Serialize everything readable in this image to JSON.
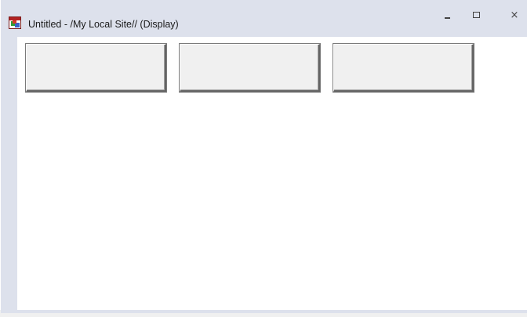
{
  "window": {
    "title": "Untitled - /My Local Site// (Display)",
    "icon": "display-app-icon"
  },
  "caption_buttons": {
    "minimize_icon": "minimize-icon",
    "maximize_icon": "maximize-icon",
    "close_icon": "close-icon",
    "close_glyph": "×"
  },
  "buttons": [
    {
      "label": ""
    },
    {
      "label": ""
    },
    {
      "label": ""
    }
  ],
  "colors": {
    "frame": "#dde1ec",
    "client_background": "#ffffff",
    "button_face": "#f0f0f0"
  }
}
